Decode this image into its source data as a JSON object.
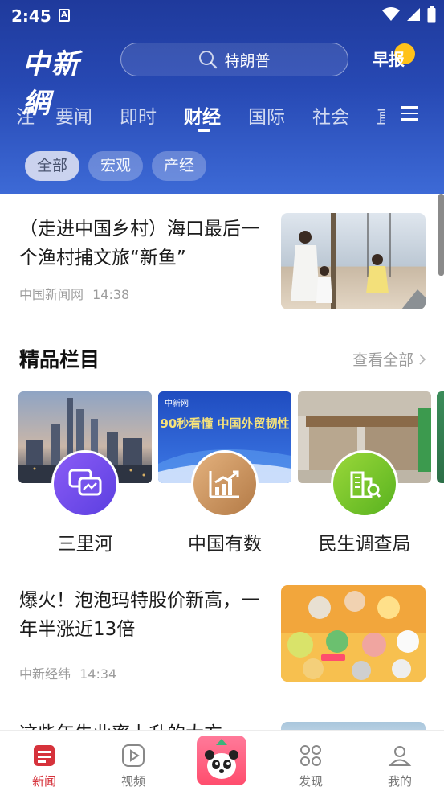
{
  "status_bar": {
    "time": "2:45",
    "notification_glyph": "A"
  },
  "header": {
    "logo_text": "中新網",
    "search_placeholder": "特朗普",
    "zaobao_label": "早报",
    "tabs": [
      "注",
      "要闻",
      "即时",
      "财经",
      "国际",
      "社会",
      "直"
    ],
    "active_tab": "财经",
    "subtabs": [
      "全部",
      "宏观",
      "产经"
    ],
    "active_subtab": "全部"
  },
  "feed": {
    "article1": {
      "title": "（走进中国乡村）海口最后一个渔村捕文旅“新鱼”",
      "source": "中国新闻网",
      "time": "14:38"
    },
    "featured": {
      "title": "精品栏目",
      "more_label": "查看全部",
      "columns": [
        {
          "label": "三里河",
          "thumb_caption": ""
        },
        {
          "label": "中国有数",
          "thumb_caption": "90秒看懂 中国外贸韧性"
        },
        {
          "label": "民生调查局",
          "thumb_caption": ""
        }
      ],
      "card2_logo": "中新网"
    },
    "article2": {
      "title": "爆火！泡泡玛特股价新高，一年半涨近13倍",
      "source": "中新经纬",
      "time": "14:34"
    },
    "article3_partial_title": "这些年失业率上升的大方"
  },
  "bottom_nav": {
    "items": [
      {
        "label": "新闻",
        "icon": "news-icon",
        "active": true
      },
      {
        "label": "视频",
        "icon": "video-icon",
        "active": false
      },
      {
        "label": "",
        "icon": "panda-icon",
        "active": false
      },
      {
        "label": "发现",
        "icon": "discover-icon",
        "active": false
      },
      {
        "label": "我的",
        "icon": "profile-icon",
        "active": false
      }
    ]
  },
  "colors": {
    "header_blue": "#2749b4",
    "active_red": "#d6323b",
    "zaobao_badge": "#ffc21a"
  }
}
